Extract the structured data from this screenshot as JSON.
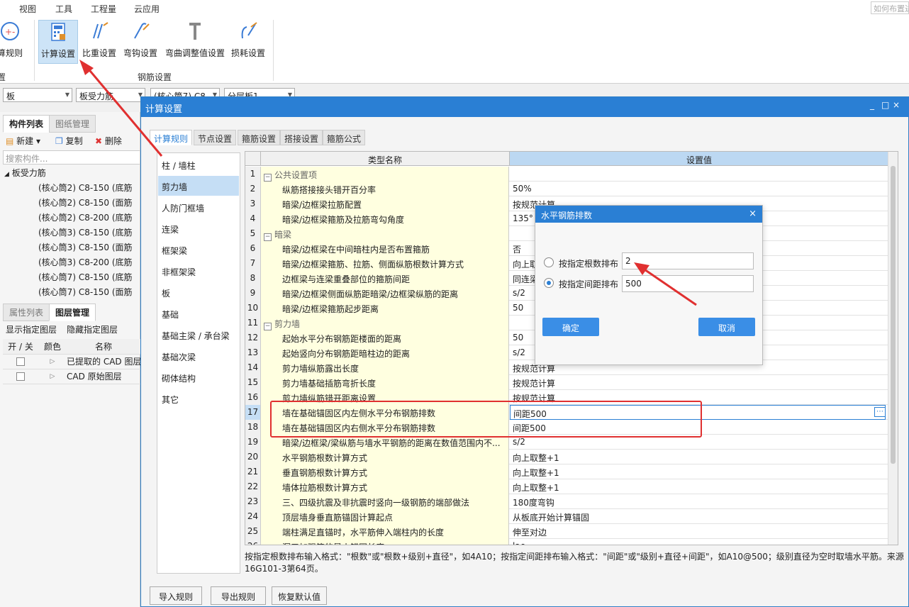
{
  "menu": [
    "视图",
    "工具",
    "工程量",
    "云应用"
  ],
  "ribbon": {
    "search_placeholder": "如何布置进",
    "partial_left_label": "算规则",
    "partial_group": "置",
    "buttons": [
      "计算设置",
      "比重设置",
      "弯钩设置",
      "弯曲调整值设置",
      "损耗设置"
    ],
    "group_label": "钢筋设置"
  },
  "selects": [
    "板",
    "板受力筋",
    "(核心筒7)  C8-",
    "分层板1"
  ],
  "left_panel": {
    "tabs": [
      "构件列表",
      "图纸管理"
    ],
    "tools": [
      "新建",
      "复制",
      "删除"
    ],
    "search_placeholder": "搜索构件...",
    "tree_root": "板受力筋",
    "tree_items": [
      "(核心筒2)  C8-150  (底筋",
      "(核心筒2)  C8-150  (面筋",
      "(核心筒2)  C8-200  (底筋",
      "(核心筒3)  C8-150  (底筋",
      "(核心筒3)  C8-150  (面筋",
      "(核心筒3)  C8-200  (底筋",
      "(核心筒7)  C8-150  (底筋",
      "(核心筒7)  C8-150  (面筋"
    ],
    "tabs2": [
      "属性列表",
      "图层管理"
    ],
    "layer_tools": [
      "显示指定图层",
      "隐藏指定图层"
    ],
    "layer_headers": [
      "开 / 关",
      "颜色",
      "名称"
    ],
    "layers": [
      "已提取的 CAD 图层",
      "CAD 原始图层"
    ]
  },
  "dialog": {
    "title": "计算设置",
    "controls": [
      "_",
      "□",
      "×"
    ],
    "tabs": [
      "计算规则",
      "节点设置",
      "箍筋设置",
      "搭接设置",
      "箍筋公式"
    ],
    "categories": [
      "柱 / 墙柱",
      "剪力墙",
      "人防门框墙",
      "连梁",
      "框架梁",
      "非框架梁",
      "板",
      "基础",
      "基础主梁 / 承台梁",
      "基础次梁",
      "砌体结构",
      "其它"
    ],
    "col_name": "类型名称",
    "col_value": "设置值",
    "rows": [
      {
        "n": "1",
        "name": "公共设置项",
        "value": "",
        "group": true
      },
      {
        "n": "2",
        "name": "纵筋搭接接头错开百分率",
        "value": "50%"
      },
      {
        "n": "3",
        "name": "暗梁/边框梁拉筋配置",
        "value": "按规范计算"
      },
      {
        "n": "4",
        "name": "暗梁/边框梁箍筋及拉筋弯勾角度",
        "value": "135°"
      },
      {
        "n": "5",
        "name": "暗梁",
        "value": "",
        "group": true
      },
      {
        "n": "6",
        "name": "暗梁/边框梁在中间暗柱内是否布置箍筋",
        "value": "否"
      },
      {
        "n": "7",
        "name": "暗梁/边框梁箍筋、拉筋、侧面纵筋根数计算方式",
        "value": "向上取"
      },
      {
        "n": "8",
        "name": "边框梁与连梁重叠部位的箍筋间距",
        "value": "同连梁"
      },
      {
        "n": "9",
        "name": "暗梁/边框梁侧面纵筋距暗梁/边框梁纵筋的距离",
        "value": "s/2"
      },
      {
        "n": "10",
        "name": "暗梁/边框梁箍筋起步距离",
        "value": "50"
      },
      {
        "n": "11",
        "name": "剪力墙",
        "value": "",
        "group": true
      },
      {
        "n": "12",
        "name": "起始水平分布钢筋距楼面的距离",
        "value": "50"
      },
      {
        "n": "13",
        "name": "起始竖向分布钢筋距暗柱边的距离",
        "value": "s/2"
      },
      {
        "n": "14",
        "name": "剪力墙纵筋露出长度",
        "value": "按规范计算"
      },
      {
        "n": "15",
        "name": "剪力墙基础插筋弯折长度",
        "value": "按规范计算"
      },
      {
        "n": "16",
        "name": "剪力墙纵筋错开距离设置",
        "value": "按规范计算"
      },
      {
        "n": "17",
        "name": "墙在基础锚固区内左侧水平分布钢筋排数",
        "value": "间距500",
        "selected": true
      },
      {
        "n": "18",
        "name": "墙在基础锚固区内右侧水平分布钢筋排数",
        "value": "间距500"
      },
      {
        "n": "19",
        "name": "暗梁/边框梁/梁纵筋与墙水平钢筋的距离在数值范围内不...",
        "value": "s/2"
      },
      {
        "n": "20",
        "name": "水平钢筋根数计算方式",
        "value": "向上取整+1"
      },
      {
        "n": "21",
        "name": "垂直钢筋根数计算方式",
        "value": "向上取整+1"
      },
      {
        "n": "22",
        "name": "墙体拉筋根数计算方式",
        "value": "向上取整+1"
      },
      {
        "n": "23",
        "name": "三、四级抗震及非抗震时竖向一级钢筋的端部做法",
        "value": "180度弯钩"
      },
      {
        "n": "24",
        "name": "顶层墙身垂直筋锚固计算起点",
        "value": "从板底开始计算锚固"
      },
      {
        "n": "25",
        "name": "端柱满足直锚时，水平筋伸入端柱内的长度",
        "value": "伸至对边"
      },
      {
        "n": "26",
        "name": "洞口加强筋的最小锚固长度",
        "value": "lae"
      }
    ],
    "hint": "按指定根数排布输入格式：\"根数\"或\"根数+级别+直径\"，如4A10；按指定间距排布输入格式：\"间距\"或\"级别+直径+间距\"，如A10@500；级别直径为空时取墙水平筋。来源16G101-3第64页。",
    "buttons": [
      "导入规则",
      "导出规则",
      "恢复默认值"
    ]
  },
  "popup": {
    "title": "水平钢筋排数",
    "close": "×",
    "option1_label": "按指定根数排布",
    "option1_value": "2",
    "option2_label": "按指定间距排布",
    "option2_value": "500",
    "selected_option": 2,
    "ok": "确定",
    "cancel": "取消"
  },
  "colors": {
    "accent": "#2a7fd4",
    "annotation": "#e03030"
  }
}
